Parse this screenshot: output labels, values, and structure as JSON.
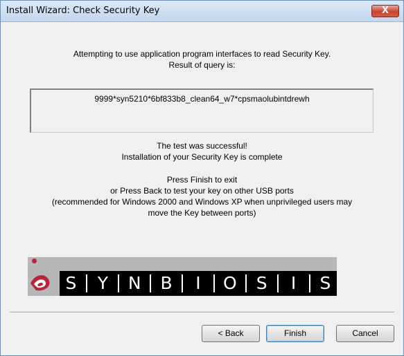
{
  "window": {
    "title": "Install Wizard: Check Security Key",
    "close_symbol": "X"
  },
  "intro": {
    "line1": "Attempting to use application program interfaces to read Security Key.",
    "line2": "Result of query is:"
  },
  "result": {
    "value": "9999*syn5210*6bf833b8_clean64_w7*cpsmaolubintdrewh"
  },
  "status": {
    "line1": "The test was successful!",
    "line2": "Installation of your Security Key is complete"
  },
  "instructions": {
    "line1": "Press Finish to exit",
    "line2": "or Press Back to test your key on other USB ports",
    "line3": "(recommended for Windows 2000 and Windows XP when unprivileged users may",
    "line4": "move the Key between ports)"
  },
  "logo": {
    "letters": [
      "S",
      "Y",
      "N",
      "B",
      "I",
      "O",
      "S",
      "I",
      "S"
    ],
    "brand_red": "#b3283a"
  },
  "buttons": {
    "back": "< Back",
    "finish": "Finish",
    "cancel": "Cancel"
  }
}
